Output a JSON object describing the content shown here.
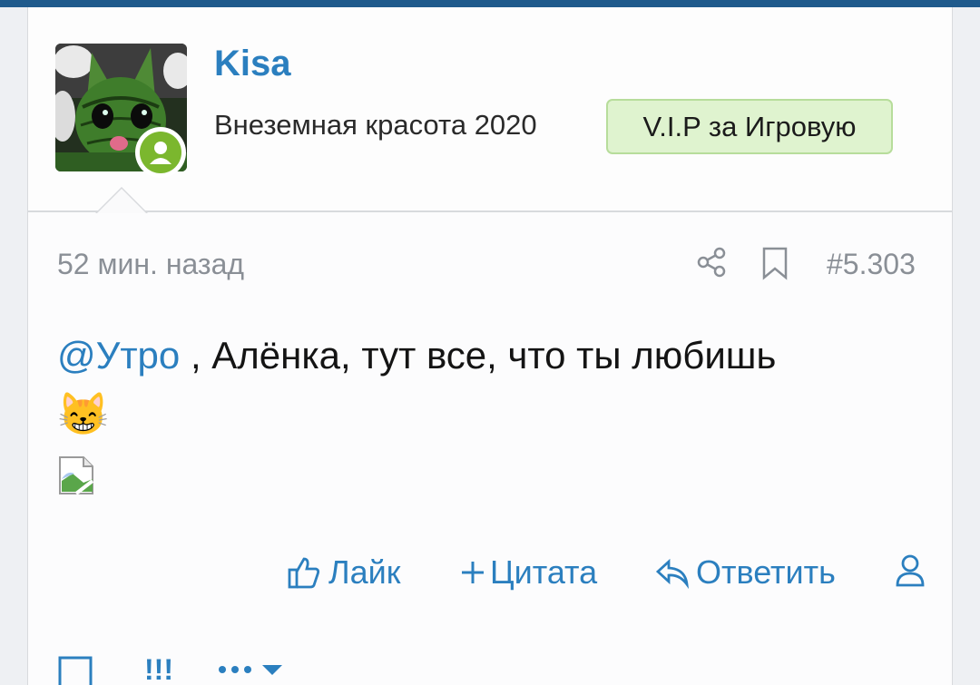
{
  "post": {
    "author": {
      "username": "Kisa",
      "title": "Внеземная красота 2020",
      "badge": "V.I.P за Игровую"
    },
    "meta": {
      "time": "52 мин. назад",
      "post_number": "#5.303"
    },
    "message": {
      "mention": "@Утро",
      "text": " , Алёнка, тут все, что ты любишь",
      "emoji": "😸"
    },
    "actions": {
      "like": "Лайк",
      "quote": "Цитата",
      "reply": "Ответить"
    },
    "footer": {
      "exclaim": "!!!"
    }
  },
  "colors": {
    "accent": "#2b7fbf",
    "topbar": "#1f5a8c",
    "badge_bg": "#dff3cf",
    "online": "#7bb72e",
    "muted": "#8a8f96"
  },
  "icons": [
    "user-icon",
    "share-icon",
    "bookmark-icon",
    "like-icon",
    "plus-icon",
    "reply-icon",
    "user-outline-icon",
    "checkbox-icon",
    "more-icon",
    "chevron-down-icon"
  ]
}
